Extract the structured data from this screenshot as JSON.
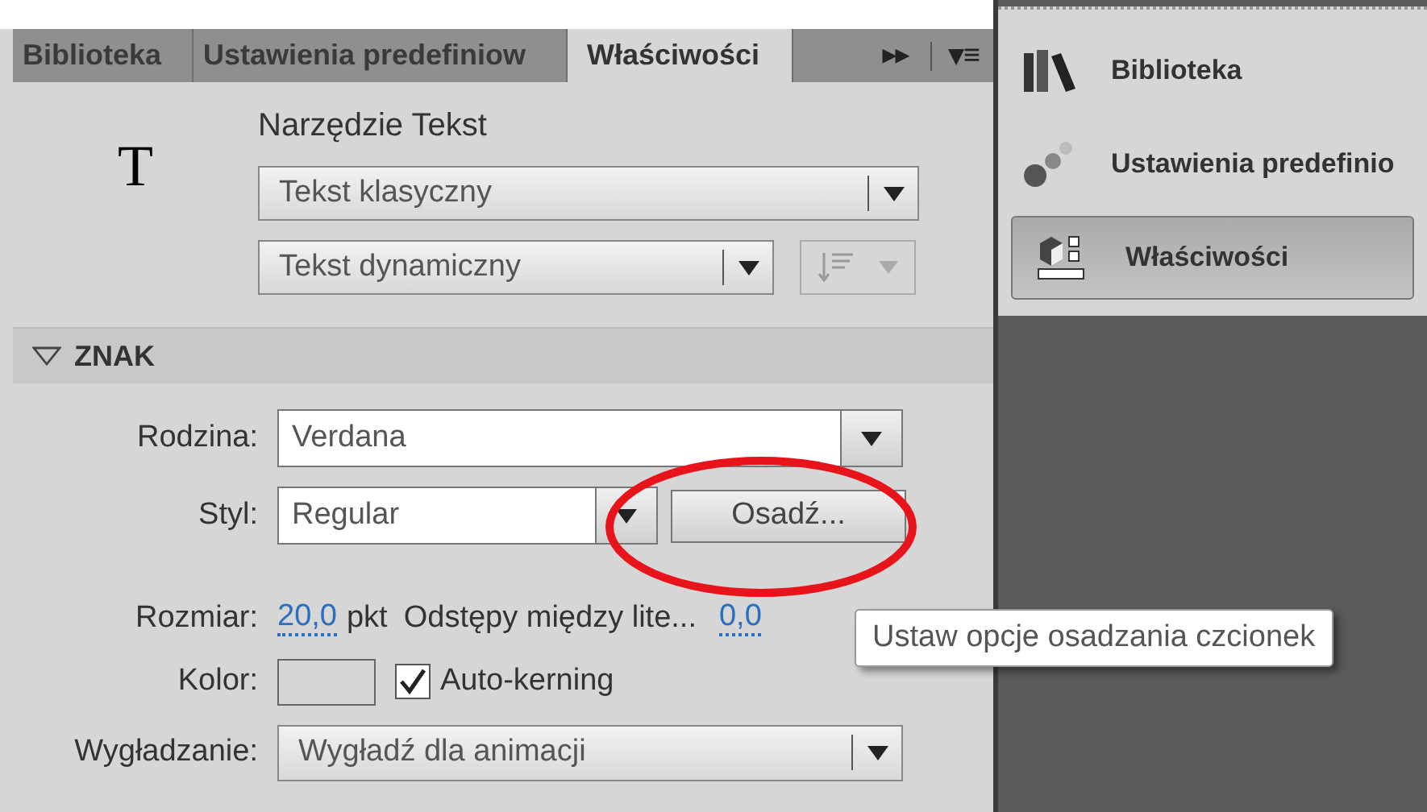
{
  "tabs": [
    {
      "label": "Biblioteka",
      "selected": false
    },
    {
      "label": "Ustawienia predefiniow",
      "selected": false
    },
    {
      "label": "Właściwości",
      "selected": true
    }
  ],
  "tab_controls": {
    "expand": "▸▸",
    "menu": "▾≡"
  },
  "tool": {
    "title": "Narzędzie Tekst",
    "icon_letter": "T",
    "text_engine": "Tekst klasyczny",
    "text_type": "Tekst dynamiczny"
  },
  "section": {
    "title": "ZNAK",
    "expanded": true
  },
  "family": {
    "label": "Rodzina:",
    "value": "Verdana"
  },
  "style": {
    "label": "Styl:",
    "value": "Regular",
    "embed_button": "Osadź..."
  },
  "size": {
    "label": "Rozmiar:",
    "value": "20,0",
    "unit": "pkt",
    "spacing_label": "Odstępy między lite...",
    "spacing_value": "0,0"
  },
  "color": {
    "label": "Kolor:",
    "autokern_label": "Auto-kerning",
    "autokern_checked": true
  },
  "antialias": {
    "label": "Wygładzanie:",
    "value": "Wygładź dla animacji"
  },
  "tooltip": "Ustaw opcje osadzania czcionek",
  "side_panel": [
    {
      "label": "Biblioteka",
      "kind": "books",
      "selected": false
    },
    {
      "label": "Ustawienia predefinio",
      "kind": "dots",
      "selected": false
    },
    {
      "label": "Właściwości",
      "kind": "properties",
      "selected": true
    }
  ]
}
